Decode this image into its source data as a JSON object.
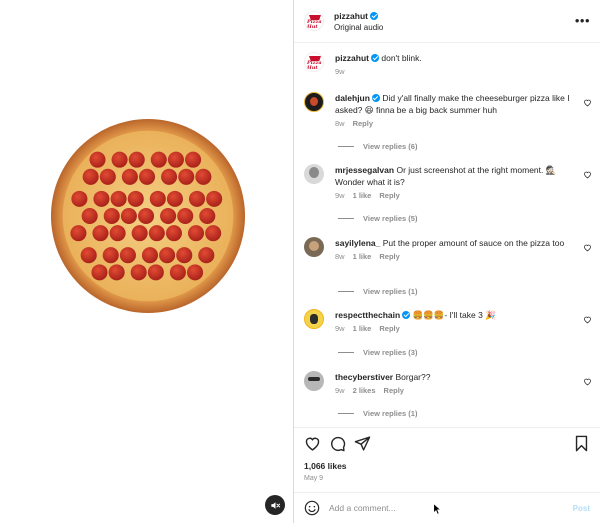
{
  "header": {
    "username": "pizzahut",
    "subtitle": "Original audio",
    "logo_text": "Pizza Hut",
    "more_icon": "more-horizontal-icon"
  },
  "caption": {
    "username": "pizzahut",
    "text": "don't blink.",
    "time": "9w"
  },
  "comments": [
    {
      "username": "dalehjun",
      "verified": true,
      "text": "Did y'all finally make the cheeseburger pizza like I asked? 😆 finna be a big back summer huh",
      "time": "8w",
      "likes": "",
      "reply_label": "Reply",
      "view_replies": "View replies (6)"
    },
    {
      "username": "mrjessegalvan",
      "verified": false,
      "text": "Or just screenshot at the right moment. 🕵🏻 Wonder what it is?",
      "time": "9w",
      "likes": "1 like",
      "reply_label": "Reply",
      "view_replies": "View replies (5)"
    },
    {
      "username": "sayilylena_",
      "verified": false,
      "text": "Put the proper amount of sauce on the pizza too",
      "time": "8w",
      "likes": "1 like",
      "reply_label": "Reply",
      "view_replies": "View replies (1)"
    },
    {
      "username": "respectthechain",
      "verified": true,
      "text": "🍔🍔🍔- I'll take 3 🎉",
      "time": "9w",
      "likes": "1 like",
      "reply_label": "Reply",
      "view_replies": "View replies (3)"
    },
    {
      "username": "thecyberstiver",
      "verified": false,
      "text": "Borgar??",
      "time": "9w",
      "likes": "2 likes",
      "reply_label": "Reply",
      "view_replies": "View replies (1)"
    }
  ],
  "actions": {
    "like_icon": "heart-icon",
    "comment_icon": "comment-icon",
    "share_icon": "share-icon",
    "save_icon": "bookmark-icon"
  },
  "likes": "1,066 likes",
  "date": "May 9",
  "add_comment": {
    "placeholder": "Add a comment...",
    "value": "",
    "post_label": "Post",
    "emoji_icon": "emoji-icon"
  },
  "media": {
    "mute_icon": "speaker-muted-icon"
  },
  "colors": {
    "verified": "#0095f6",
    "brand_red": "#c8102e",
    "meta_gray": "#8e8e8e",
    "post_disabled": "#b2dffc"
  }
}
